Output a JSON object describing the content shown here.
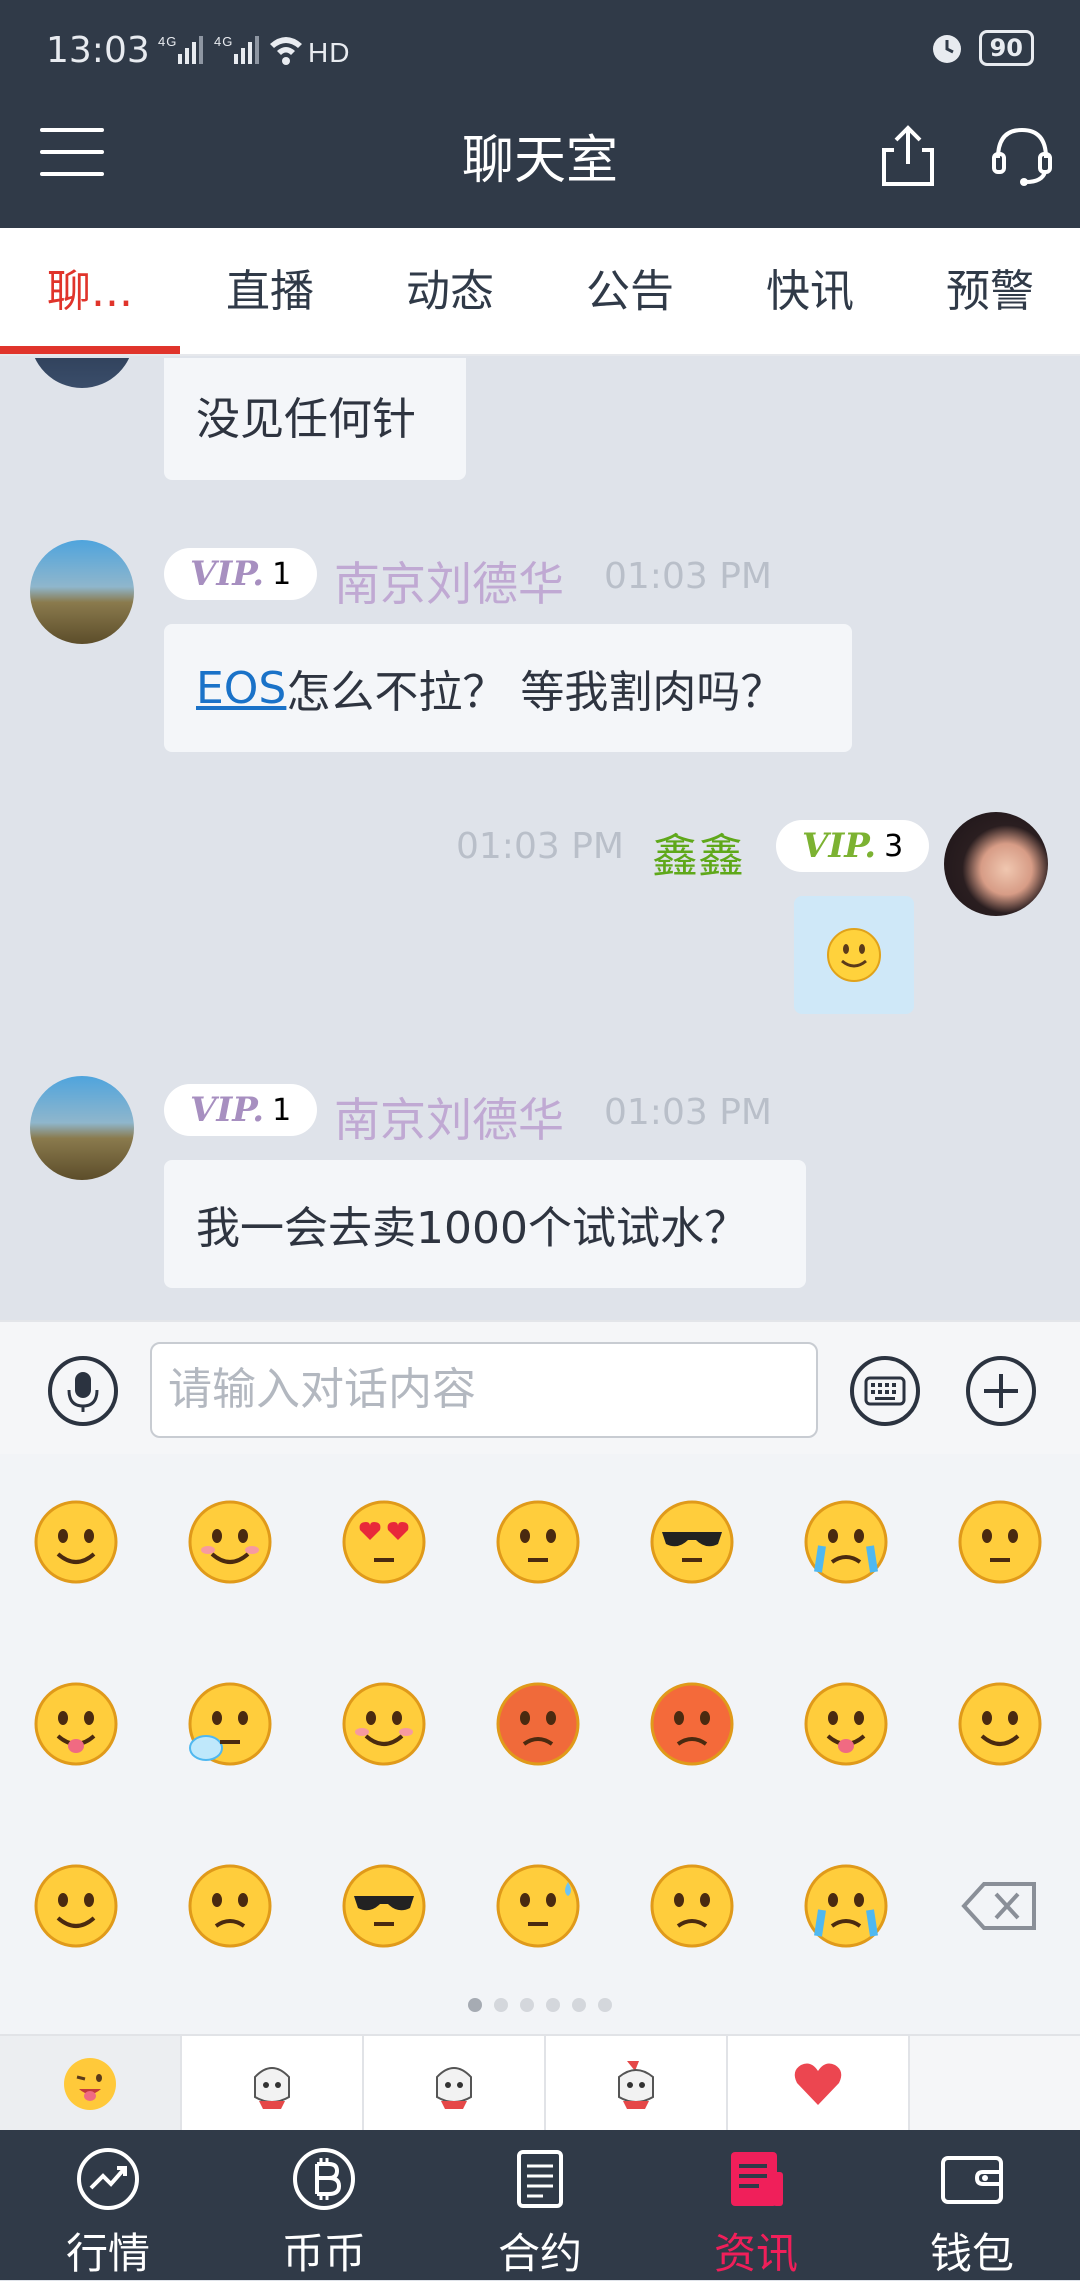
{
  "status": {
    "time": "13:03",
    "signal": "4G 4G",
    "wifi_hd": "HD",
    "battery": "90"
  },
  "header": {
    "title": "聊天室"
  },
  "tabs": [
    {
      "label": "聊..."
    },
    {
      "label": "直播"
    },
    {
      "label": "动态"
    },
    {
      "label": "公告"
    },
    {
      "label": "快讯"
    },
    {
      "label": "预警"
    }
  ],
  "messages": [
    {
      "text": "没见任何针"
    },
    {
      "vip_level": "1",
      "name": "南京刘德华",
      "time": "01:03 PM",
      "text_link": "EOS",
      "text": "怎么不拉？ 等我割肉吗？"
    },
    {
      "vip_level": "3",
      "name": "鑫鑫",
      "time": "01:03 PM",
      "self": true
    },
    {
      "vip_level": "1",
      "name": "南京刘德华",
      "time": "01:03 PM",
      "text": "我一会去卖1000个试试水？"
    }
  ],
  "vip_mark": "VIP.",
  "input": {
    "placeholder": "请输入对话内容"
  },
  "emoji_page": {
    "count": 6,
    "current": 1
  },
  "colors": {
    "header": "#303a48",
    "active_tab": "#e0342b",
    "self_name": "#5fa81a",
    "other_name": "#c0a9d3",
    "nav_active": "#f01f5a"
  },
  "nav": [
    {
      "label": "行情",
      "icon": "chart-trend-icon"
    },
    {
      "label": "币币",
      "icon": "bitcoin-icon"
    },
    {
      "label": "合约",
      "icon": "document-icon"
    },
    {
      "label": "资讯",
      "icon": "news-icon",
      "active": true
    },
    {
      "label": "钱包",
      "icon": "wallet-icon"
    }
  ]
}
